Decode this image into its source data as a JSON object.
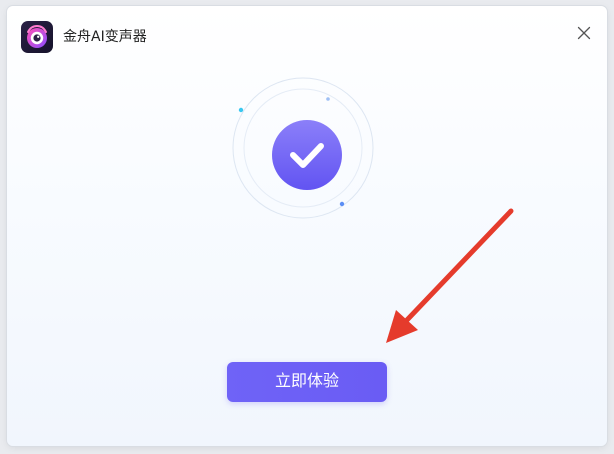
{
  "window": {
    "app_title": "金舟AI变声器",
    "app_icon": "app-logo-icon",
    "close_icon": "close-icon"
  },
  "main": {
    "status_icon": "checkmark-icon",
    "cta_label": "立即体验"
  },
  "colors": {
    "accent": "#6a5cf4",
    "accent_light": "#7b6ff8",
    "ring": "#dce6f3",
    "dot_cyan": "#39c8f0",
    "dot_blue": "#5b8ef5",
    "annotation_arrow": "#e53b2c"
  }
}
